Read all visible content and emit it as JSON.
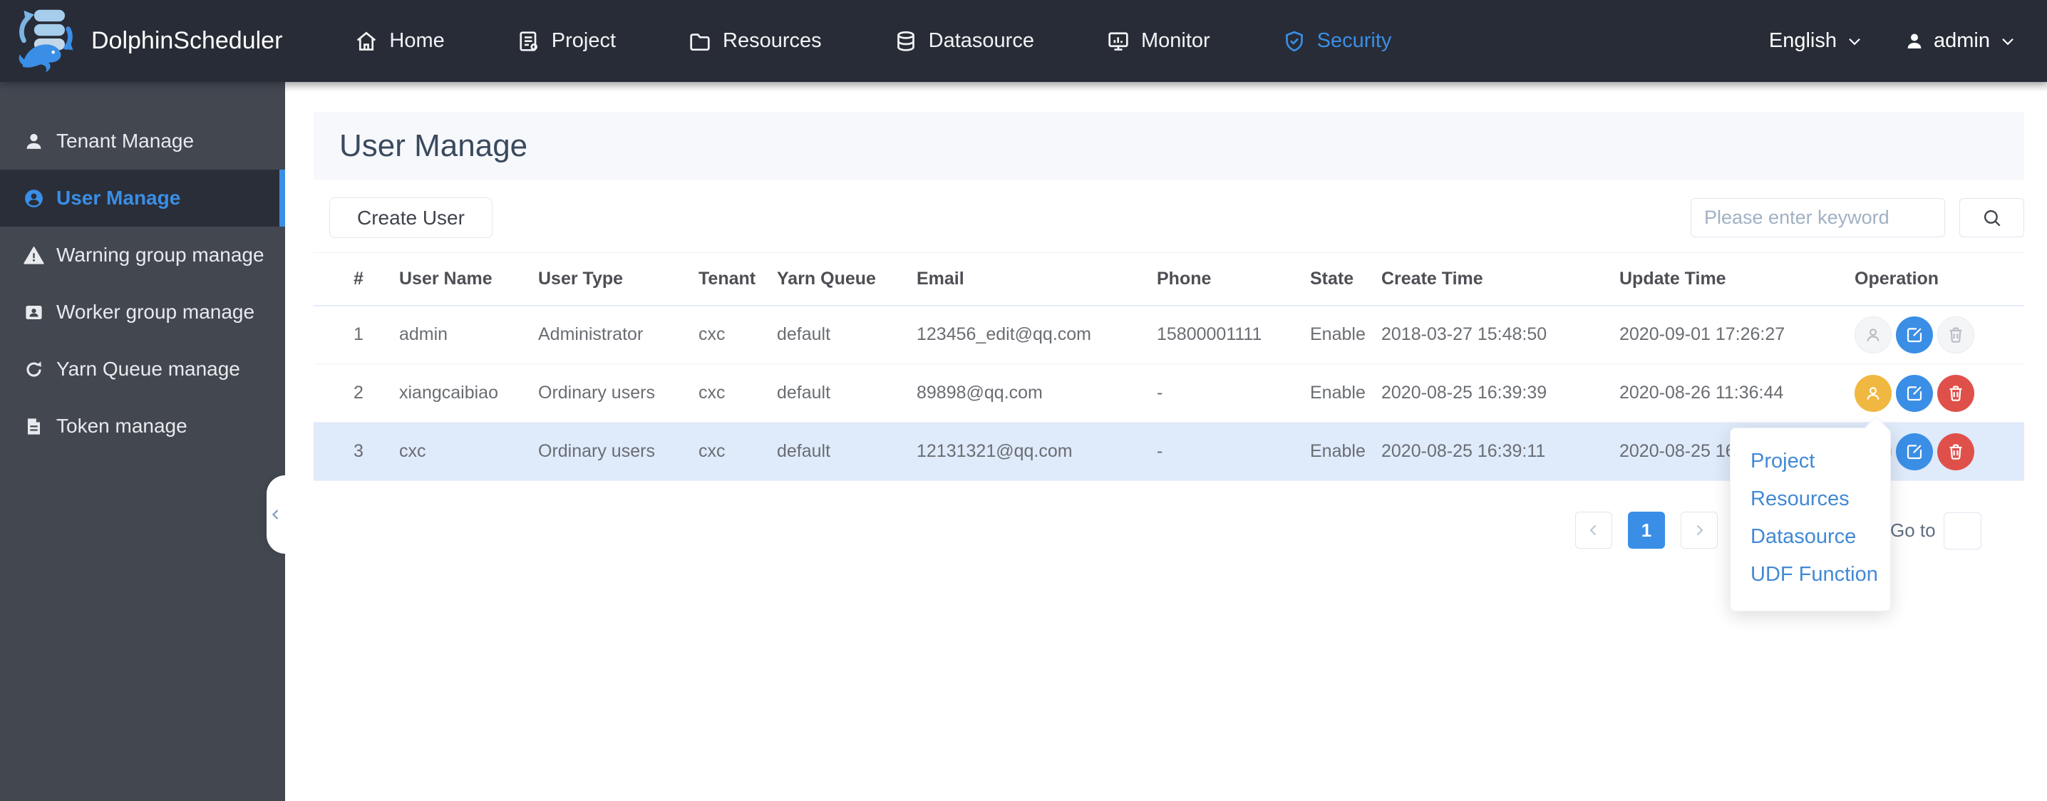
{
  "topnav": {
    "brand": "DolphinScheduler",
    "items": [
      {
        "label": "Home",
        "icon": "home-icon"
      },
      {
        "label": "Project",
        "icon": "project-icon"
      },
      {
        "label": "Resources",
        "icon": "resources-icon"
      },
      {
        "label": "Datasource",
        "icon": "datasource-icon"
      },
      {
        "label": "Monitor",
        "icon": "monitor-icon"
      },
      {
        "label": "Security",
        "icon": "security-icon",
        "active": true
      }
    ],
    "language": "English",
    "user": "admin"
  },
  "sidebar": {
    "items": [
      {
        "label": "Tenant Manage",
        "icon": "tenant-icon",
        "active": false
      },
      {
        "label": "User Manage",
        "icon": "user-circle-icon",
        "active": true
      },
      {
        "label": "Warning group manage",
        "icon": "warning-icon",
        "active": false
      },
      {
        "label": "Worker group manage",
        "icon": "worker-icon",
        "active": false
      },
      {
        "label": "Yarn Queue manage",
        "icon": "yarn-queue-icon",
        "active": false
      },
      {
        "label": "Token manage",
        "icon": "token-icon",
        "active": false
      }
    ]
  },
  "page": {
    "title": "User Manage",
    "create_button_label": "Create User",
    "search_placeholder": "Please enter keyword"
  },
  "table": {
    "columns": [
      "#",
      "User Name",
      "User Type",
      "Tenant",
      "Yarn Queue",
      "Email",
      "Phone",
      "State",
      "Create Time",
      "Update Time",
      "Operation"
    ],
    "rows": [
      {
        "index": "1",
        "user_name": "admin",
        "user_type": "Administrator",
        "tenant": "cxc",
        "yarn_queue": "default",
        "email": "123456_edit@qq.com",
        "phone": "15800001111",
        "state": "Enable",
        "create_time": "2018-03-27 15:48:50",
        "update_time": "2020-09-01 17:26:27",
        "highlighted": false,
        "ops": {
          "authorize": "disabled",
          "edit": "primary",
          "delete": "disabled"
        }
      },
      {
        "index": "2",
        "user_name": "xiangcaibiao",
        "user_type": "Ordinary users",
        "tenant": "cxc",
        "yarn_queue": "default",
        "email": "89898@qq.com",
        "phone": "-",
        "state": "Enable",
        "create_time": "2020-08-25 16:39:39",
        "update_time": "2020-08-26 11:36:44",
        "highlighted": false,
        "ops": {
          "authorize": "warning",
          "edit": "primary",
          "delete": "danger"
        }
      },
      {
        "index": "3",
        "user_name": "cxc",
        "user_type": "Ordinary users",
        "tenant": "cxc",
        "yarn_queue": "default",
        "email": "12131321@qq.com",
        "phone": "-",
        "state": "Enable",
        "create_time": "2020-08-25 16:39:11",
        "update_time": "2020-08-25 16",
        "highlighted": true,
        "ops": {
          "authorize": "warning",
          "edit": "primary",
          "delete": "danger"
        }
      }
    ]
  },
  "authorize_menu": {
    "items": [
      "Project",
      "Resources",
      "Datasource",
      "UDF Function"
    ]
  },
  "pagination": {
    "current_page": "1",
    "goto_label": "Go to",
    "goto_value": ""
  },
  "colors": {
    "accent": "#3a8ee6",
    "warning": "#f0b840",
    "danger": "#e0504a",
    "topnav_bg": "#282c36",
    "sidebar_bg": "#424750",
    "sidebar_active_bg": "#2a2e38",
    "row_highlight": "#dfeafb",
    "title_band_bg": "#f6f8fc"
  }
}
